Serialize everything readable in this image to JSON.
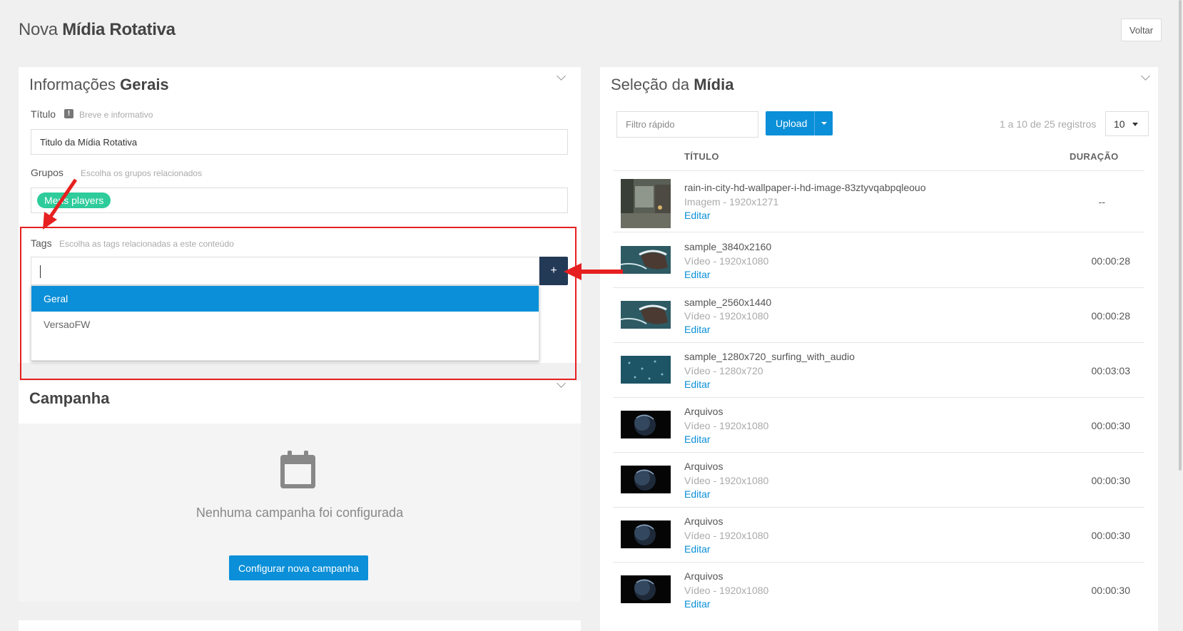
{
  "page": {
    "title_light": "Nova ",
    "title_bold": "Mídia Rotativa",
    "back_label": "Voltar"
  },
  "info": {
    "heading_light": "Informações ",
    "heading_bold": "Gerais",
    "title_label": "Título",
    "title_hint": "Breve e informativo",
    "title_value": "Titulo da Mídia Rotativa",
    "groups_label": "Grupos",
    "groups_hint": "Escolha os grupos relacionados",
    "group_chip": "Meus players",
    "tags_label": "Tags",
    "tags_hint": "Escolha as tags relacionadas a este conteúdo",
    "tags_value": "",
    "add_tag_label": "+",
    "tag_options": [
      "Geral",
      "VersaoFW"
    ]
  },
  "campaign": {
    "heading": "Campanha",
    "empty_text": "Nenhuma campanha foi configurada",
    "configure_label": "Configurar nova campanha"
  },
  "media": {
    "heading_light": "Seleção da ",
    "heading_bold": "Mídia",
    "search_placeholder": "Filtro rápido",
    "upload_label": "Upload",
    "count_text": "1 a 10 de 25 registros",
    "page_size": "10",
    "col_title": "TÍTULO",
    "col_duration": "DURAÇÃO",
    "edit_label": "Editar",
    "rows": [
      {
        "title": "rain-in-city-hd-wallpaper-i-hd-image-83ztyvqabpqleouo",
        "sub": "Imagem - 1920x1271",
        "duration": "--"
      },
      {
        "title": "sample_3840x2160",
        "sub": "Vídeo - 1920x1080",
        "duration": "00:00:28"
      },
      {
        "title": "sample_2560x1440",
        "sub": "Vídeo - 1920x1080",
        "duration": "00:00:28"
      },
      {
        "title": "sample_1280x720_surfing_with_audio",
        "sub": "Vídeo - 1280x720",
        "duration": "00:03:03"
      },
      {
        "title": "Arquivos",
        "sub": "Vídeo - 1920x1080",
        "duration": "00:00:30"
      },
      {
        "title": "Arquivos",
        "sub": "Vídeo - 1920x1080",
        "duration": "00:00:30"
      },
      {
        "title": "Arquivos",
        "sub": "Vídeo - 1920x1080",
        "duration": "00:00:30"
      },
      {
        "title": "Arquivos",
        "sub": "Vídeo - 1920x1080",
        "duration": "00:00:30"
      }
    ]
  },
  "icons": {
    "panel_toggle": "chevron-down-icon",
    "calendar": "calendar-icon",
    "info": "exclamation-icon",
    "upload_menu": "caret-down-icon",
    "select": "caret-down-icon"
  },
  "colors": {
    "primary": "#0a8fd8",
    "navy": "#233a57",
    "chip": "#2ecc9a",
    "annotation": "#e62020"
  }
}
